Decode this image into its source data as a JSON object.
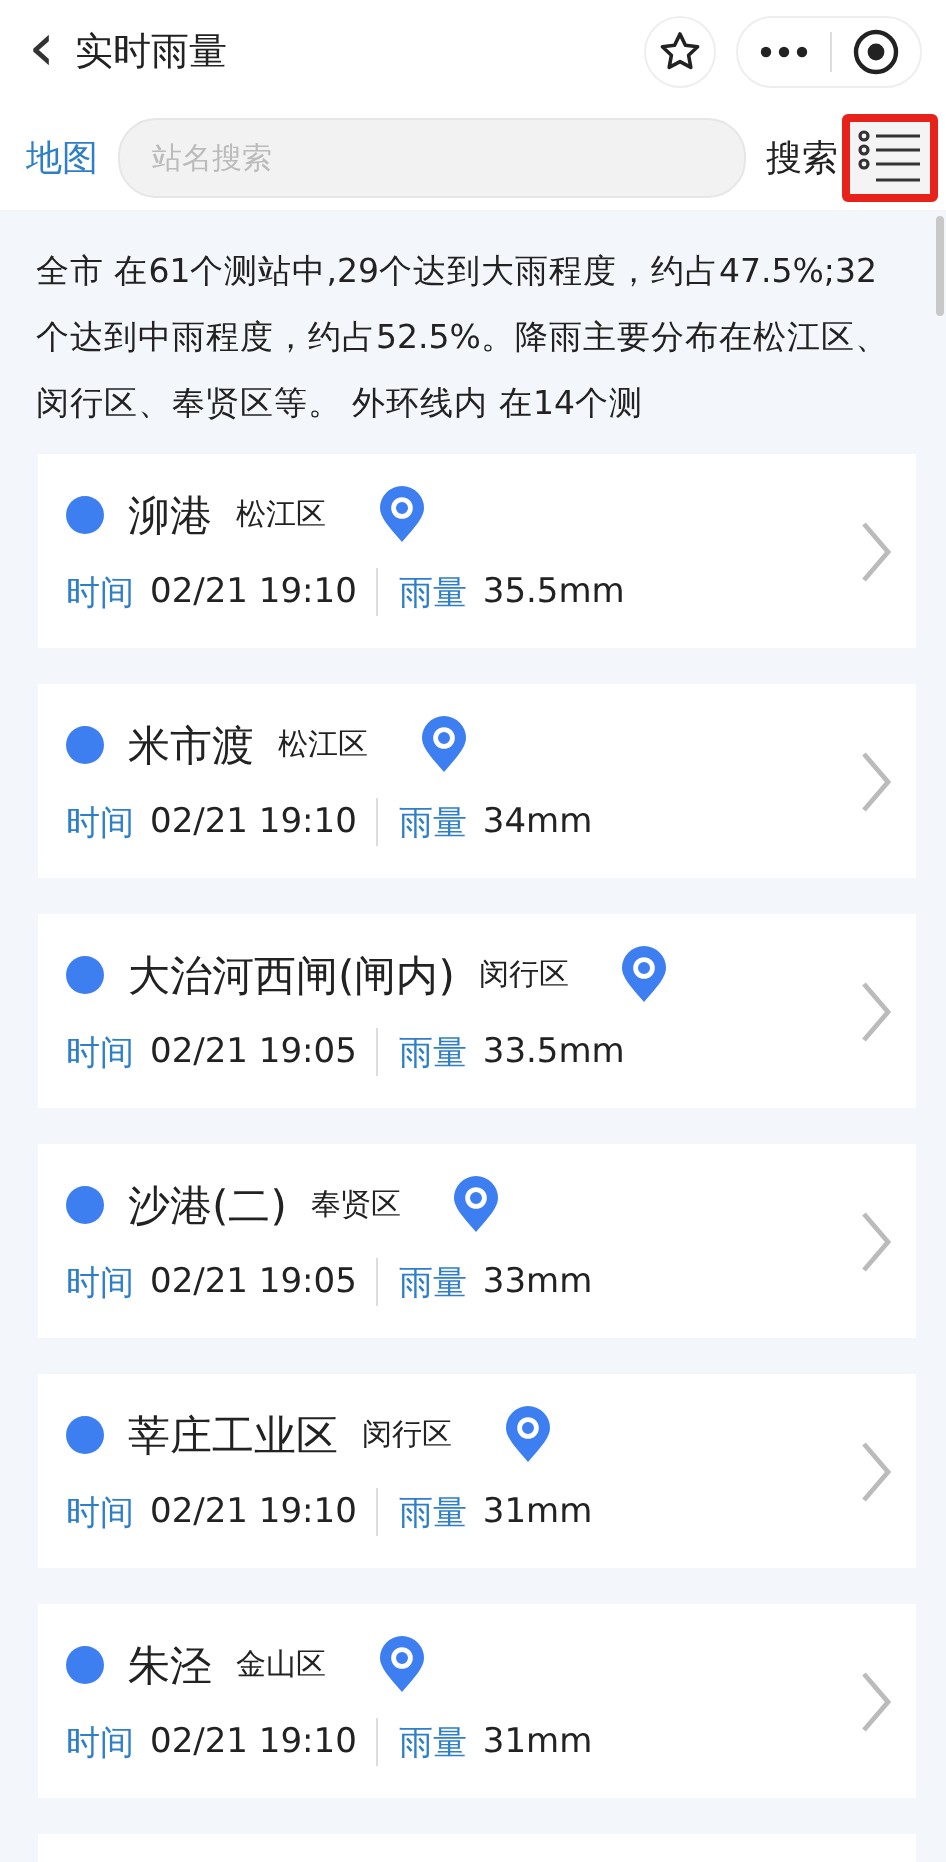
{
  "header": {
    "title": "实时雨量",
    "back": "‹"
  },
  "search": {
    "map_link": "地图",
    "placeholder": "站名搜索",
    "button": "搜索",
    "highlighted": true
  },
  "summary": {
    "text": "全市 在61个测站中,29个达到大雨程度，约占47.5%;32个达到中雨程度，约占52.5%。降雨主要分布在松江区、闵行区、奉贤区等。 外环线内 在14个测"
  },
  "stations": [
    {
      "name": "泖港",
      "district": "松江区",
      "color": "#3d7ff0",
      "time_label": "时间",
      "time": "02/21 19:10",
      "rain_label": "雨量",
      "rain": "35.5mm"
    },
    {
      "name": "米市渡",
      "district": "松江区",
      "color": "#3d7ff0",
      "time_label": "时间",
      "time": "02/21 19:10",
      "rain_label": "雨量",
      "rain": "34mm"
    },
    {
      "name": "大治河西闸(闸内)",
      "district": "闵行区",
      "color": "#3d7ff0",
      "time_label": "时间",
      "time": "02/21 19:05",
      "rain_label": "雨量",
      "rain": "33.5mm"
    },
    {
      "name": "沙港(二)",
      "district": "奉贤区",
      "color": "#3d7ff0",
      "time_label": "时间",
      "time": "02/21 19:05",
      "rain_label": "雨量",
      "rain": "33mm"
    },
    {
      "name": "莘庄工业区",
      "district": "闵行区",
      "color": "#3d7ff0",
      "time_label": "时间",
      "time": "02/21 19:10",
      "rain_label": "雨量",
      "rain": "31mm"
    },
    {
      "name": "朱泾",
      "district": "金山区",
      "color": "#3d7ff0",
      "time_label": "时间",
      "time": "02/21 19:10",
      "rain_label": "雨量",
      "rain": "31mm"
    }
  ]
}
